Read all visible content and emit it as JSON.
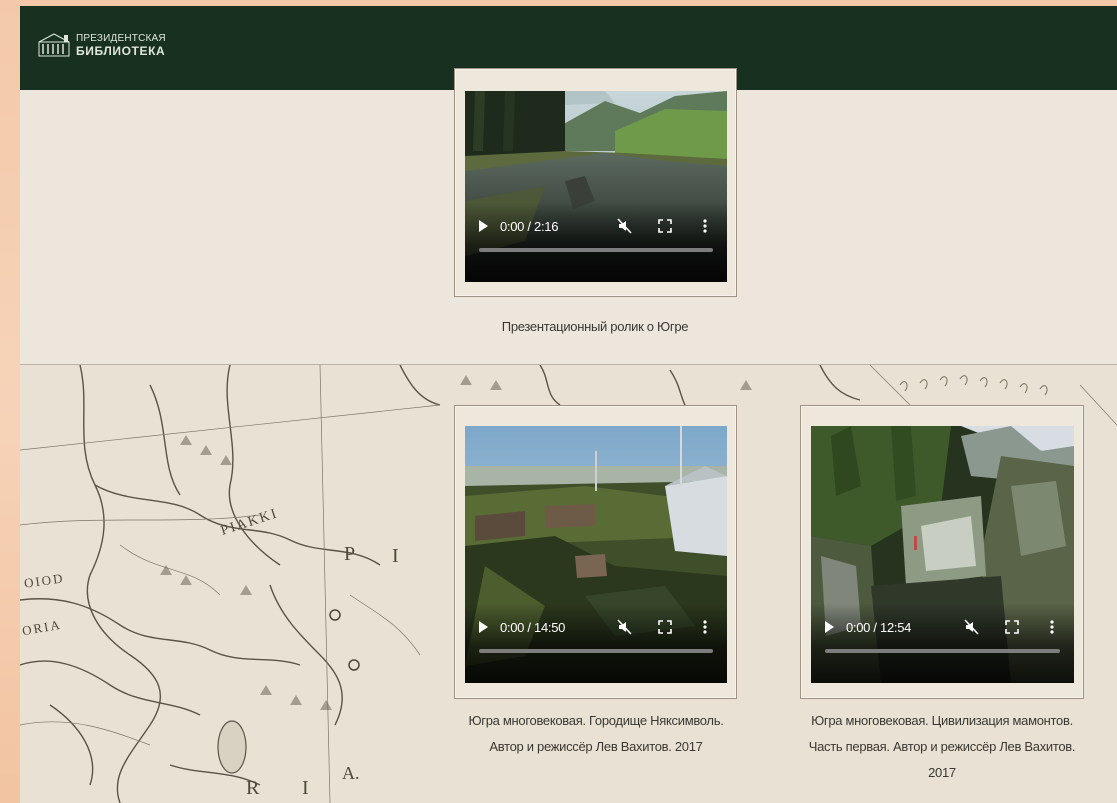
{
  "header": {
    "logo_line1": "ПРЕЗИДЕНТСКАЯ",
    "logo_line2": "БИБЛИОТЕКА",
    "brand_bg": "#17301f"
  },
  "map_labels": {
    "piakki": "PIAKKI",
    "p": "P",
    "i": "I",
    "r": "R",
    "i2": "I",
    "a": "A.",
    "oiod": "OIOD",
    "oria": "ORIA"
  },
  "videos": [
    {
      "time": "0:00 / 2:16",
      "caption": "Презентационный ролик о Югре",
      "thumb": "river-valley"
    },
    {
      "time": "0:00 / 14:50",
      "caption_lines": [
        "Югра многовековая. Городище Няксимволь.",
        "Автор и режиссёр Лев Вахитов. 2017"
      ],
      "thumb": "village-hill"
    },
    {
      "time": "0:00 / 12:54",
      "caption_lines": [
        "Югра многовековая. Цивилизация мамонтов.",
        "Часть первая. Автор и режиссёр Лев Вахитов.",
        "2017"
      ],
      "thumb": "rocky-gorge"
    }
  ],
  "icons": {
    "play": "play-icon",
    "mute": "volume-muted-icon",
    "fullscreen": "fullscreen-icon",
    "more": "more-vertical-icon"
  }
}
